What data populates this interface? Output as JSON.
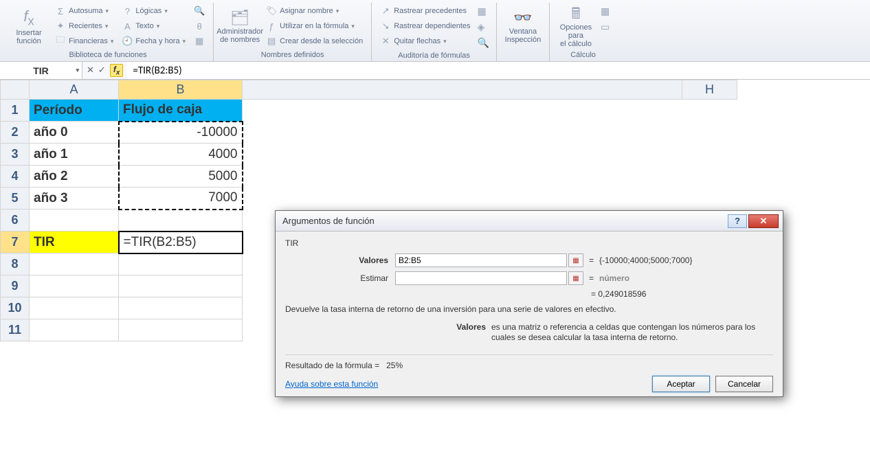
{
  "ribbon": {
    "insert_fn_top": "Insertar",
    "insert_fn_bottom": "función",
    "autosum": "Autosuma",
    "recent": "Recientes",
    "financial": "Financieras",
    "logical": "Lógicas",
    "text": "Texto",
    "datetime": "Fecha y hora",
    "group1_label": "Biblioteca de funciones",
    "name_mgr_top": "Administrador",
    "name_mgr_bottom": "de nombres",
    "assign_name": "Asignar nombre",
    "use_in_formula": "Utilizar en la fórmula",
    "create_from_sel": "Crear desde la selección",
    "group2_label": "Nombres definidos",
    "trace_prec": "Rastrear precedentes",
    "trace_dep": "Rastrear dependientes",
    "remove_arrows": "Quitar flechas",
    "group3_label": "Auditoría de fórmulas",
    "watch_top": "Ventana",
    "watch_bottom": "Inspección",
    "calc_opts_top": "Opciones para",
    "calc_opts_bottom": "el cálculo",
    "group4_label": "Cálculo"
  },
  "formula_bar": {
    "name_box": "TIR",
    "formula": "=TIR(B2:B5)"
  },
  "columns": [
    "A",
    "B",
    "H"
  ],
  "rows": [
    "1",
    "2",
    "3",
    "4",
    "5",
    "6",
    "7",
    "8",
    "9",
    "10",
    "11"
  ],
  "cells": {
    "A1": "Período",
    "B1": "Flujo de caja",
    "A2": "año 0",
    "B2": "-10000",
    "A3": "año 1",
    "B3": "4000",
    "A4": "año 2",
    "B4": "5000",
    "A5": "año 3",
    "B5": "7000",
    "A7": "TIR",
    "B7": "=TIR(B2:B5)"
  },
  "dialog": {
    "title": "Argumentos de función",
    "func_name": "TIR",
    "arg1_label": "Valores",
    "arg1_value": "B2:B5",
    "arg1_eval": "{-10000;4000;5000;7000}",
    "arg2_label": "Estimar",
    "arg2_value": "",
    "arg2_eval": "número",
    "result_eval": "0,249018596",
    "description": "Devuelve la tasa interna de retorno de una inversión para una serie de valores en efectivo.",
    "argdesc_label": "Valores",
    "argdesc_text": "es una matriz o referencia a celdas que contengan los números para los cuales se desea calcular la tasa interna de retorno.",
    "formula_result_label": "Resultado de la fórmula =",
    "formula_result_value": "25%",
    "help_link": "Ayuda sobre esta función",
    "ok": "Aceptar",
    "cancel": "Cancelar"
  }
}
